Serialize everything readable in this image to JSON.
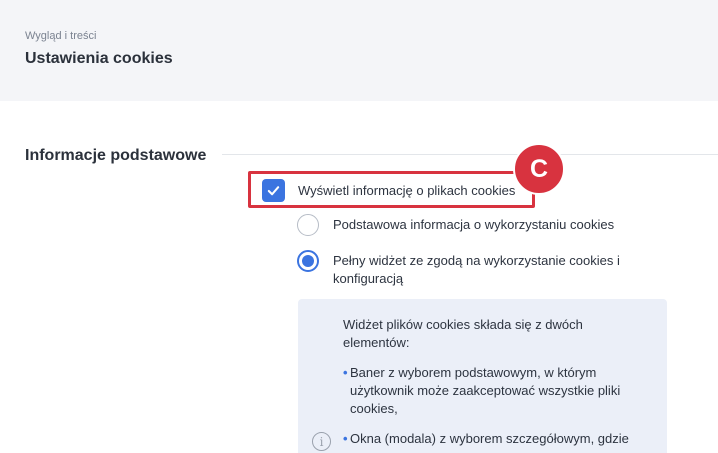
{
  "header": {
    "breadcrumb": "Wygląd i treści",
    "title": "Ustawienia cookies"
  },
  "section": {
    "title": "Informacje podstawowe"
  },
  "annotation": {
    "badge_label": "C",
    "highlight_color": "#d8333f"
  },
  "settings": {
    "show_cookie_info": {
      "label": "Wyświetl informację o plikach cookies",
      "checked": true
    },
    "mode_options": [
      {
        "label": "Podstawowa informacja o wykorzystaniu cookies",
        "selected": false
      },
      {
        "label": "Pełny widżet ze zgodą na wykorzystanie cookies i konfiguracją",
        "selected": true
      }
    ]
  },
  "info_panel": {
    "icon": "info-icon",
    "intro": "Widżet plików cookies składa się z dwóch elementów:",
    "bullets": [
      "Baner z wyborem podstawowym, w którym użytkownik może zaakceptować wszystkie pliki cookies,",
      "Okna (modala) z wyborem szczegółowym, gdzie"
    ]
  },
  "colors": {
    "accent": "#3b74e0",
    "header_bg": "#f4f5f8",
    "panel_bg": "#ebeff8"
  }
}
